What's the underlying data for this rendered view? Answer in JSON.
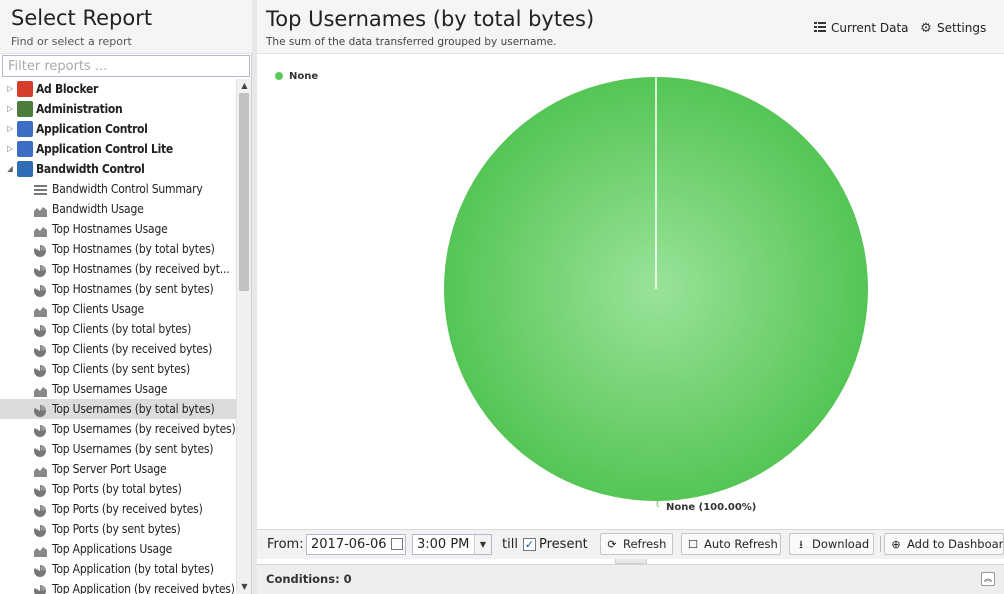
{
  "sidebar": {
    "title": "Select Report",
    "subtitle": "Find or select a report",
    "filter_placeholder": "Filter reports ...",
    "categories": [
      {
        "label": "Ad Blocker",
        "icon": "ad-blocker-icon",
        "color": "#d43c2c",
        "expanded": false
      },
      {
        "label": "Administration",
        "icon": "administration-icon",
        "color": "#4a7c3a",
        "expanded": false
      },
      {
        "label": "Application Control",
        "icon": "application-control-icon",
        "color": "#3c6fc4",
        "expanded": false
      },
      {
        "label": "Application Control Lite",
        "icon": "application-control-lite-icon",
        "color": "#3c6fc4",
        "expanded": false
      },
      {
        "label": "Bandwidth Control",
        "icon": "bandwidth-control-icon",
        "color": "#2f6db5",
        "expanded": true
      }
    ],
    "items": [
      {
        "label": "Bandwidth Control Summary",
        "icon": "list-icon"
      },
      {
        "label": "Bandwidth Usage",
        "icon": "area-chart-icon"
      },
      {
        "label": "Top Hostnames Usage",
        "icon": "area-chart-icon"
      },
      {
        "label": "Top Hostnames (by total bytes)",
        "icon": "pie-chart-icon"
      },
      {
        "label": "Top Hostnames (by received byt...",
        "icon": "pie-chart-icon"
      },
      {
        "label": "Top Hostnames (by sent bytes)",
        "icon": "pie-chart-icon"
      },
      {
        "label": "Top Clients Usage",
        "icon": "area-chart-icon"
      },
      {
        "label": "Top Clients (by total bytes)",
        "icon": "pie-chart-icon"
      },
      {
        "label": "Top Clients (by received bytes)",
        "icon": "pie-chart-icon"
      },
      {
        "label": "Top Clients (by sent bytes)",
        "icon": "pie-chart-icon"
      },
      {
        "label": "Top Usernames Usage",
        "icon": "area-chart-icon"
      },
      {
        "label": "Top Usernames (by total bytes)",
        "icon": "pie-chart-icon",
        "selected": true
      },
      {
        "label": "Top Usernames (by received bytes)",
        "icon": "pie-chart-icon"
      },
      {
        "label": "Top Usernames (by sent bytes)",
        "icon": "pie-chart-icon"
      },
      {
        "label": "Top Server Port Usage",
        "icon": "area-chart-icon"
      },
      {
        "label": "Top Ports (by total bytes)",
        "icon": "pie-chart-icon"
      },
      {
        "label": "Top Ports (by received bytes)",
        "icon": "pie-chart-icon"
      },
      {
        "label": "Top Ports (by sent bytes)",
        "icon": "pie-chart-icon"
      },
      {
        "label": "Top Applications Usage",
        "icon": "area-chart-icon"
      },
      {
        "label": "Top Application (by total bytes)",
        "icon": "pie-chart-icon"
      },
      {
        "label": "Top Application (by received bytes)",
        "icon": "pie-chart-icon"
      }
    ]
  },
  "header": {
    "title": "Top Usernames (by total bytes)",
    "subtitle": "The sum of the data transferred grouped by username.",
    "current_data_label": "Current Data",
    "settings_label": "Settings"
  },
  "chart_data": {
    "type": "pie",
    "title": "",
    "categories": [
      "None"
    ],
    "values": [
      100
    ],
    "data_labels": [
      "None (100.00%)"
    ],
    "legend": [
      "None"
    ],
    "legend_placement": "top-left",
    "colors": [
      "#5bc85b"
    ]
  },
  "toolbar": {
    "from_label": "From:",
    "date_value": "2017-06-06",
    "time_value": "3:00 PM",
    "till_label": "till",
    "present_checked": true,
    "present_label": "Present",
    "refresh_label": "Refresh",
    "auto_refresh_label": "Auto Refresh",
    "download_label": "Download",
    "add_dashboard_label": "Add to Dashboard"
  },
  "conditions": {
    "label": "Conditions: 0"
  }
}
